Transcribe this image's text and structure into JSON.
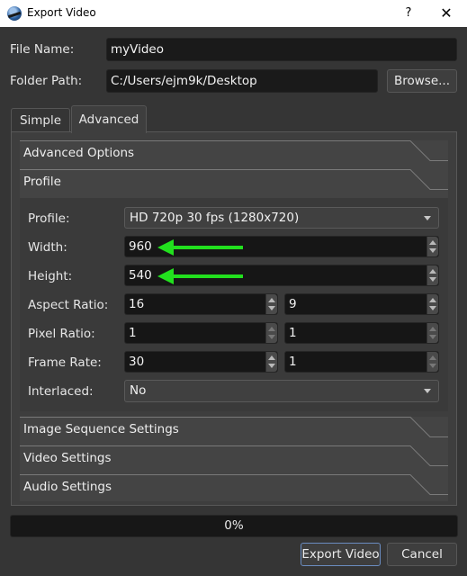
{
  "window": {
    "title": "Export Video",
    "help_label": "?",
    "close_label": "✕"
  },
  "file": {
    "file_name_label": "File Name:",
    "file_name_value": "myVideo",
    "folder_path_label": "Folder Path:",
    "folder_path_value": "C:/Users/ejm9k/Desktop",
    "browse_label": "Browse..."
  },
  "tabs": [
    {
      "label": "Simple",
      "active": false
    },
    {
      "label": "Advanced",
      "active": true
    }
  ],
  "sections": {
    "advanced_options": "Advanced Options",
    "profile": "Profile",
    "image_sequence": "Image Sequence Settings",
    "video": "Video Settings",
    "audio": "Audio Settings"
  },
  "profile": {
    "profile_label": "Profile:",
    "profile_value": "HD 720p 30 fps (1280x720)",
    "width_label": "Width:",
    "width_value": "960",
    "height_label": "Height:",
    "height_value": "540",
    "aspect_label": "Aspect Ratio:",
    "aspect_num": "16",
    "aspect_den": "9",
    "pixel_label": "Pixel Ratio:",
    "pixel_num": "1",
    "pixel_den": "1",
    "frame_label": "Frame Rate:",
    "frame_num": "30",
    "frame_den": "1",
    "interlaced_label": "Interlaced:",
    "interlaced_value": "No"
  },
  "annotations": {
    "arrow_color": "#22e01e"
  },
  "progress": {
    "text": "0%",
    "value": 0
  },
  "actions": {
    "export_label": "Export Video",
    "cancel_label": "Cancel"
  }
}
